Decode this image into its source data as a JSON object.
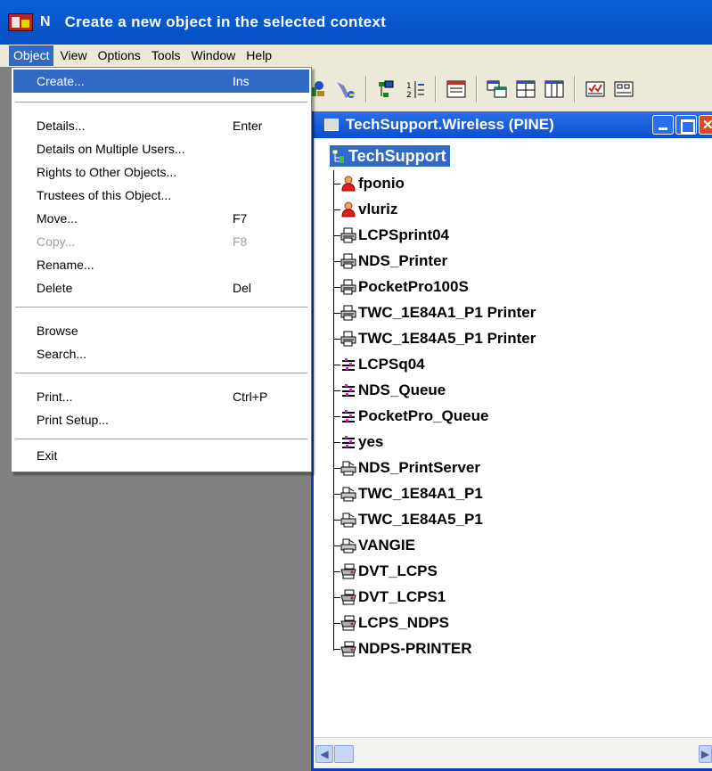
{
  "titlebar": {
    "app_letter": "N",
    "title": "Create a new object in the selected context"
  },
  "menubar": {
    "items": [
      "Object",
      "View",
      "Options",
      "Tools",
      "Window",
      "Help"
    ]
  },
  "menu": {
    "items": [
      {
        "label": "Create...",
        "shortcut": "Ins"
      },
      {
        "label": "Details...",
        "shortcut": "Enter"
      },
      {
        "label": "Details on Multiple Users...",
        "shortcut": ""
      },
      {
        "label": "Rights to Other Objects...",
        "shortcut": ""
      },
      {
        "label": "Trustees of this Object...",
        "shortcut": ""
      },
      {
        "label": "Move...",
        "shortcut": "F7"
      },
      {
        "label": "Copy...",
        "shortcut": "F8"
      },
      {
        "label": "Rename...",
        "shortcut": ""
      },
      {
        "label": "Delete",
        "shortcut": "Del"
      },
      {
        "label": "Browse",
        "shortcut": ""
      },
      {
        "label": "Search...",
        "shortcut": ""
      },
      {
        "label": "Print...",
        "shortcut": "Ctrl+P"
      },
      {
        "label": "Print Setup...",
        "shortcut": ""
      },
      {
        "label": "Exit",
        "shortcut": ""
      }
    ]
  },
  "browser": {
    "title": "TechSupport.Wireless (PINE)",
    "root": "TechSupport",
    "nodes": [
      {
        "label": "fponio",
        "icon": "user-icon"
      },
      {
        "label": "vluriz",
        "icon": "user-icon"
      },
      {
        "label": "LCPSprint04",
        "icon": "printer-icon"
      },
      {
        "label": "NDS_Printer",
        "icon": "printer-icon"
      },
      {
        "label": "PocketPro100S",
        "icon": "printer-icon"
      },
      {
        "label": "TWC_1E84A1_P1 Printer",
        "icon": "printer-icon"
      },
      {
        "label": "TWC_1E84A5_P1 Printer",
        "icon": "printer-icon"
      },
      {
        "label": "LCPSq04",
        "icon": "print-queue-icon"
      },
      {
        "label": "NDS_Queue",
        "icon": "print-queue-icon"
      },
      {
        "label": "PocketPro_Queue",
        "icon": "print-queue-icon"
      },
      {
        "label": "yes",
        "icon": "print-queue-icon"
      },
      {
        "label": "NDS_PrintServer",
        "icon": "print-server-icon"
      },
      {
        "label": "TWC_1E84A1_P1",
        "icon": "print-server-icon"
      },
      {
        "label": "TWC_1E84A5_P1",
        "icon": "print-server-icon"
      },
      {
        "label": "VANGIE",
        "icon": "print-server-icon"
      },
      {
        "label": "DVT_LCPS",
        "icon": "ndps-printer-icon"
      },
      {
        "label": "DVT_LCPS1",
        "icon": "ndps-printer-icon"
      },
      {
        "label": "LCPS_NDPS",
        "icon": "ndps-printer-icon"
      },
      {
        "label": "NDPS-PRINTER",
        "icon": "ndps-printer-icon"
      }
    ]
  },
  "colors": {
    "selection": "#316ac5",
    "titlebar": "#0550c4",
    "menu_bg": "#ece9d8",
    "workspace": "#808080"
  }
}
